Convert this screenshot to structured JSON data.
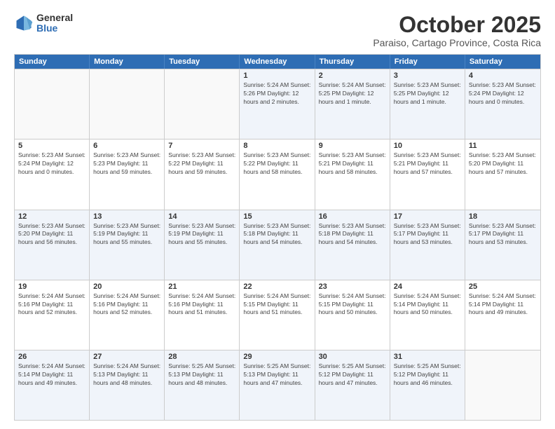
{
  "logo": {
    "general": "General",
    "blue": "Blue"
  },
  "header": {
    "month": "October 2025",
    "location": "Paraiso, Cartago Province, Costa Rica"
  },
  "dayHeaders": [
    "Sunday",
    "Monday",
    "Tuesday",
    "Wednesday",
    "Thursday",
    "Friday",
    "Saturday"
  ],
  "weeks": [
    [
      {
        "day": "",
        "info": ""
      },
      {
        "day": "",
        "info": ""
      },
      {
        "day": "",
        "info": ""
      },
      {
        "day": "1",
        "info": "Sunrise: 5:24 AM\nSunset: 5:26 PM\nDaylight: 12 hours\nand 2 minutes."
      },
      {
        "day": "2",
        "info": "Sunrise: 5:24 AM\nSunset: 5:25 PM\nDaylight: 12 hours\nand 1 minute."
      },
      {
        "day": "3",
        "info": "Sunrise: 5:23 AM\nSunset: 5:25 PM\nDaylight: 12 hours\nand 1 minute."
      },
      {
        "day": "4",
        "info": "Sunrise: 5:23 AM\nSunset: 5:24 PM\nDaylight: 12 hours\nand 0 minutes."
      }
    ],
    [
      {
        "day": "5",
        "info": "Sunrise: 5:23 AM\nSunset: 5:24 PM\nDaylight: 12 hours\nand 0 minutes."
      },
      {
        "day": "6",
        "info": "Sunrise: 5:23 AM\nSunset: 5:23 PM\nDaylight: 11 hours\nand 59 minutes."
      },
      {
        "day": "7",
        "info": "Sunrise: 5:23 AM\nSunset: 5:22 PM\nDaylight: 11 hours\nand 59 minutes."
      },
      {
        "day": "8",
        "info": "Sunrise: 5:23 AM\nSunset: 5:22 PM\nDaylight: 11 hours\nand 58 minutes."
      },
      {
        "day": "9",
        "info": "Sunrise: 5:23 AM\nSunset: 5:21 PM\nDaylight: 11 hours\nand 58 minutes."
      },
      {
        "day": "10",
        "info": "Sunrise: 5:23 AM\nSunset: 5:21 PM\nDaylight: 11 hours\nand 57 minutes."
      },
      {
        "day": "11",
        "info": "Sunrise: 5:23 AM\nSunset: 5:20 PM\nDaylight: 11 hours\nand 57 minutes."
      }
    ],
    [
      {
        "day": "12",
        "info": "Sunrise: 5:23 AM\nSunset: 5:20 PM\nDaylight: 11 hours\nand 56 minutes."
      },
      {
        "day": "13",
        "info": "Sunrise: 5:23 AM\nSunset: 5:19 PM\nDaylight: 11 hours\nand 55 minutes."
      },
      {
        "day": "14",
        "info": "Sunrise: 5:23 AM\nSunset: 5:19 PM\nDaylight: 11 hours\nand 55 minutes."
      },
      {
        "day": "15",
        "info": "Sunrise: 5:23 AM\nSunset: 5:18 PM\nDaylight: 11 hours\nand 54 minutes."
      },
      {
        "day": "16",
        "info": "Sunrise: 5:23 AM\nSunset: 5:18 PM\nDaylight: 11 hours\nand 54 minutes."
      },
      {
        "day": "17",
        "info": "Sunrise: 5:23 AM\nSunset: 5:17 PM\nDaylight: 11 hours\nand 53 minutes."
      },
      {
        "day": "18",
        "info": "Sunrise: 5:23 AM\nSunset: 5:17 PM\nDaylight: 11 hours\nand 53 minutes."
      }
    ],
    [
      {
        "day": "19",
        "info": "Sunrise: 5:24 AM\nSunset: 5:16 PM\nDaylight: 11 hours\nand 52 minutes."
      },
      {
        "day": "20",
        "info": "Sunrise: 5:24 AM\nSunset: 5:16 PM\nDaylight: 11 hours\nand 52 minutes."
      },
      {
        "day": "21",
        "info": "Sunrise: 5:24 AM\nSunset: 5:16 PM\nDaylight: 11 hours\nand 51 minutes."
      },
      {
        "day": "22",
        "info": "Sunrise: 5:24 AM\nSunset: 5:15 PM\nDaylight: 11 hours\nand 51 minutes."
      },
      {
        "day": "23",
        "info": "Sunrise: 5:24 AM\nSunset: 5:15 PM\nDaylight: 11 hours\nand 50 minutes."
      },
      {
        "day": "24",
        "info": "Sunrise: 5:24 AM\nSunset: 5:14 PM\nDaylight: 11 hours\nand 50 minutes."
      },
      {
        "day": "25",
        "info": "Sunrise: 5:24 AM\nSunset: 5:14 PM\nDaylight: 11 hours\nand 49 minutes."
      }
    ],
    [
      {
        "day": "26",
        "info": "Sunrise: 5:24 AM\nSunset: 5:14 PM\nDaylight: 11 hours\nand 49 minutes."
      },
      {
        "day": "27",
        "info": "Sunrise: 5:24 AM\nSunset: 5:13 PM\nDaylight: 11 hours\nand 48 minutes."
      },
      {
        "day": "28",
        "info": "Sunrise: 5:25 AM\nSunset: 5:13 PM\nDaylight: 11 hours\nand 48 minutes."
      },
      {
        "day": "29",
        "info": "Sunrise: 5:25 AM\nSunset: 5:13 PM\nDaylight: 11 hours\nand 47 minutes."
      },
      {
        "day": "30",
        "info": "Sunrise: 5:25 AM\nSunset: 5:12 PM\nDaylight: 11 hours\nand 47 minutes."
      },
      {
        "day": "31",
        "info": "Sunrise: 5:25 AM\nSunset: 5:12 PM\nDaylight: 11 hours\nand 46 minutes."
      },
      {
        "day": "",
        "info": ""
      }
    ]
  ]
}
